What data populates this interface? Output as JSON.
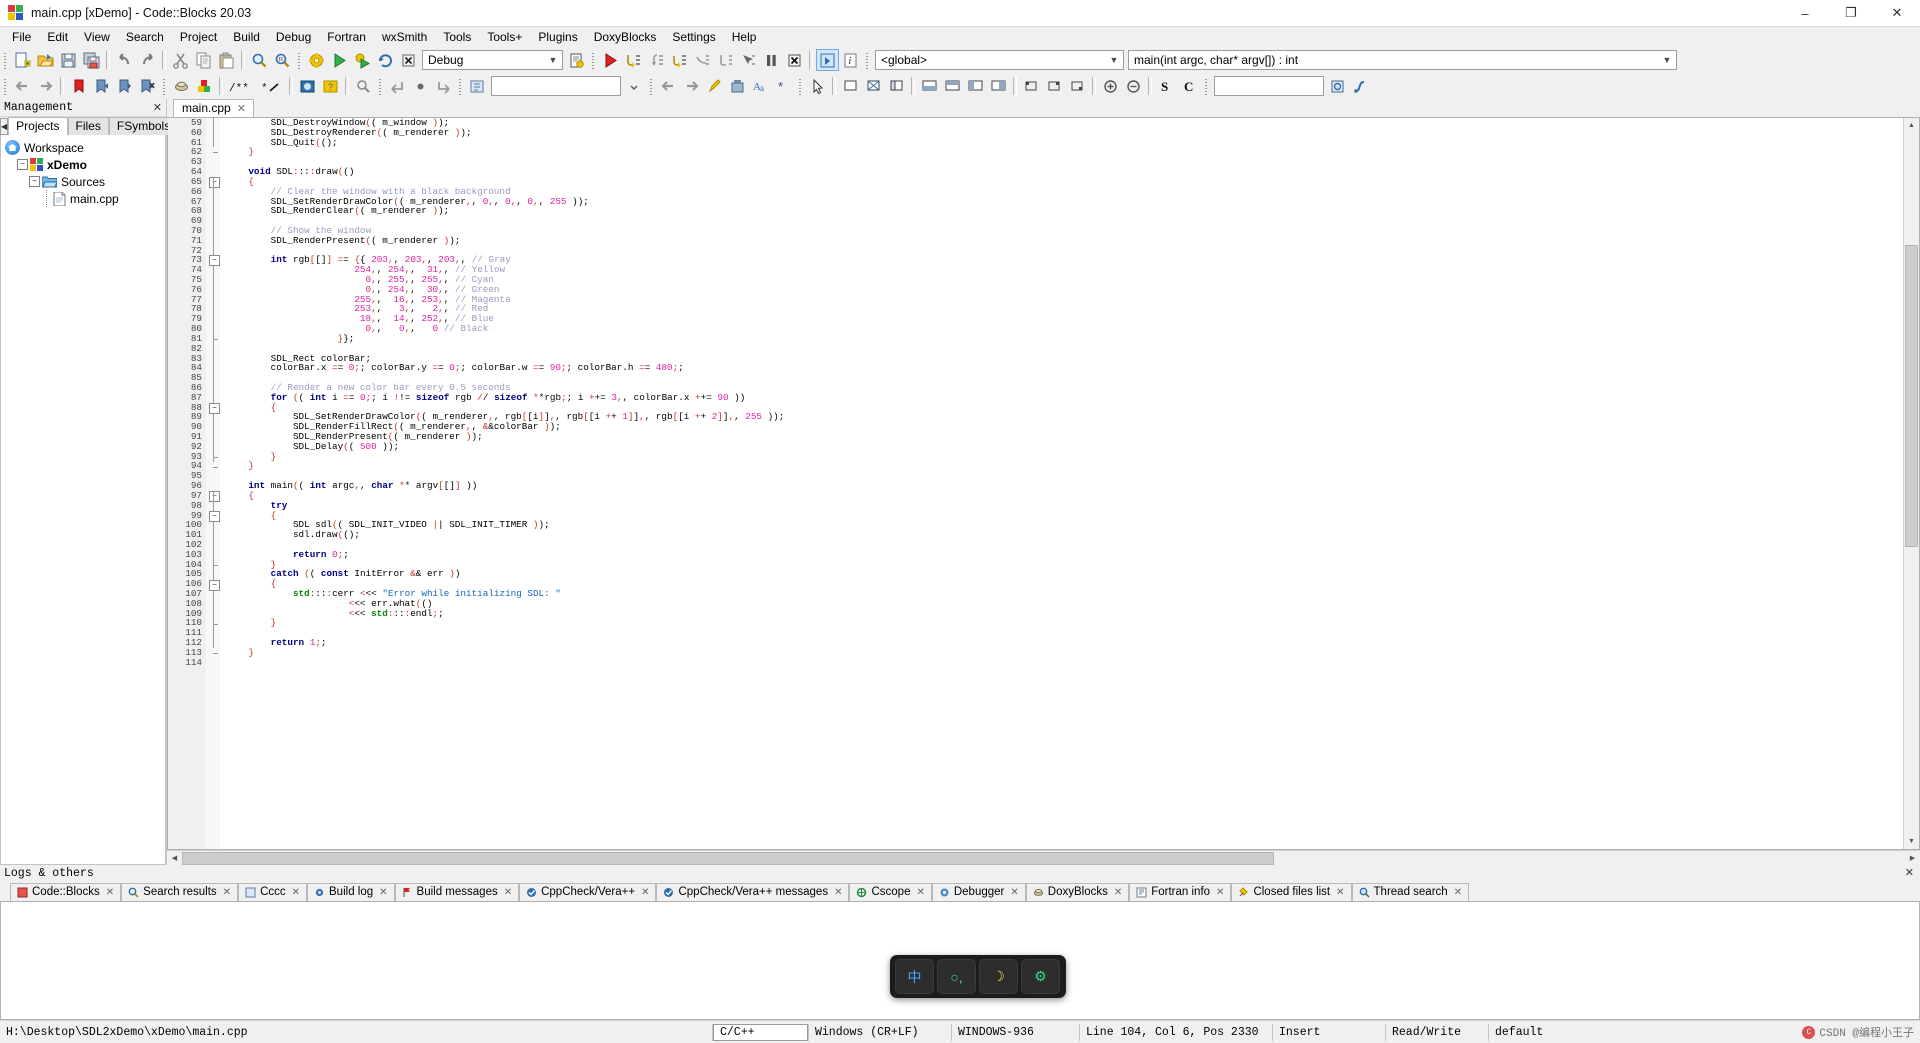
{
  "window": {
    "title": "main.cpp [xDemo] - Code::Blocks 20.03",
    "minimize": "–",
    "maximize": "❐",
    "close": "✕"
  },
  "menubar": [
    "File",
    "Edit",
    "View",
    "Search",
    "Project",
    "Build",
    "Debug",
    "Fortran",
    "wxSmith",
    "Tools",
    "Tools+",
    "Plugins",
    "DoxyBlocks",
    "Settings",
    "Help"
  ],
  "toolbars": {
    "main_icons": [
      "new-file-icon",
      "open-file-icon",
      "save-icon",
      "save-all-icon",
      "undo-icon",
      "redo-icon",
      "cut-icon",
      "copy-icon",
      "paste-icon",
      "find-icon",
      "replace-icon"
    ],
    "build_icons": [
      "build-icon",
      "run-icon",
      "build-and-run-icon",
      "rebuild-icon",
      "abort-icon"
    ],
    "target_combo": "Debug",
    "target_aux_icon": "select-target-icon",
    "debug_icons": [
      "debug-continue-icon",
      "step-into-icon",
      "step-out-icon",
      "next-line-icon",
      "next-instruction-icon",
      "step-into-instruction-icon",
      "run-to-cursor-icon",
      "break-debugger-icon",
      "stop-debugger-icon",
      "debugging-windows-icon",
      "various-info-icon"
    ],
    "scope_combo": "<global>",
    "function_combo": "main(int argc, char* argv[]) : int",
    "row2_icons": [
      "back-icon",
      "forward-icon",
      "toggle-bookmark-icon",
      "prev-bookmark-icon",
      "next-bookmark-icon",
      "clear-bookmarks-icon",
      "doxyblocks-extract-icon",
      "doxyblocks-wizard-icon",
      "comment-block-icon",
      "uncomment-icon",
      "doxyblocks-run-icon",
      "doxyblocks-help-icon",
      "doxyblocks-config-icon",
      "prev-changed-line-icon",
      "toggle-changebar-icon",
      "next-changed-line-icon",
      "fortran-workspace-icon"
    ],
    "fortran_combo": "",
    "row2b_icons": [
      "wxsmith-pointer-icon",
      "wxsmith-panel-icon",
      "wxsmith-dialog-icon",
      "wxsmith-frame-icon",
      "layout-h1-icon",
      "layout-h2-icon",
      "layout-v1-icon",
      "layout-v2-icon",
      "align-left-icon",
      "align-center-icon",
      "align-right-icon",
      "zoom-in-icon",
      "zoom-out-icon"
    ],
    "sc_labels": [
      "S",
      "C"
    ],
    "search_combo": "",
    "search_icons": [
      "search-files-icon",
      "search-symbol-icon"
    ]
  },
  "management": {
    "title": "Management",
    "close_icon": "✕",
    "scroll_left_icon": "◀",
    "tabs": [
      {
        "label": "Projects",
        "active": true
      },
      {
        "label": "Files",
        "active": false
      },
      {
        "label": "FSymbols",
        "active": false
      }
    ],
    "tree": [
      {
        "label": "Workspace",
        "icon": "workspace-home-icon",
        "depth": 0,
        "bold": false,
        "expander": ""
      },
      {
        "label": "xDemo",
        "icon": "project-icon",
        "depth": 1,
        "bold": true,
        "expander": "−"
      },
      {
        "label": "Sources",
        "icon": "folder-icon",
        "depth": 2,
        "bold": false,
        "expander": "−"
      },
      {
        "label": "main.cpp",
        "icon": "cpp-file-icon",
        "depth": 3,
        "bold": false,
        "expander": ""
      }
    ]
  },
  "editor": {
    "tabs": [
      {
        "label": "main.cpp",
        "close": "✕",
        "active": true
      }
    ],
    "first_line": 59,
    "lines": [
      {
        "n": 59,
        "t": "        SDL_DestroyWindow@(( m_window @));"
      },
      {
        "n": 60,
        "t": "        SDL_DestroyRenderer@(( m_renderer @));"
      },
      {
        "n": 61,
        "t": "        SDL_Quit@(();"
      },
      {
        "n": 62,
        "t": "    @}"
      },
      {
        "n": 63,
        "t": ""
      },
      {
        "n": 64,
        "t": "    @kvoid@ SDL@:::@:draw@(()"
      },
      {
        "n": 65,
        "t": "    @{"
      },
      {
        "n": 66,
        "t": "        @c// Clear the window with a black background"
      },
      {
        "n": 67,
        "t": "        SDL_SetRenderDrawColor@(( m_renderer@,, @n0@,, @n0@,, @n0@,, @n255@ ));"
      },
      {
        "n": 68,
        "t": "        SDL_RenderClear@(( m_renderer @));"
      },
      {
        "n": 69,
        "t": ""
      },
      {
        "n": 70,
        "t": "        @c// Show the window"
      },
      {
        "n": 71,
        "t": "        SDL_RenderPresent@(( m_renderer @));"
      },
      {
        "n": 72,
        "t": ""
      },
      {
        "n": 73,
        "t": "        @kint@ rgb@[[]@] @== @{{ @n203@,, @n203@,, @n203@,, @c// Gray"
      },
      {
        "n": 74,
        "t": "                       @n254@,, @n254@,,  @n31@,, @c// Yellow"
      },
      {
        "n": 75,
        "t": "                         @n0@,, @n255@,, @n255@,, @c// Cyan"
      },
      {
        "n": 76,
        "t": "                         @n0@,, @n254@,,  @n30@,, @c// Green"
      },
      {
        "n": 77,
        "t": "                       @n255@,,  @n16@,, @n253@,, @c// Magenta"
      },
      {
        "n": 78,
        "t": "                       @n253@,,   @n3@,,   @n2@,, @c// Red"
      },
      {
        "n": 79,
        "t": "                        @n18@,,  @n14@,, @n252@,, @c// Blue"
      },
      {
        "n": 80,
        "t": "                         @n0@,,   @n0@,,   @n0@ @c// Black"
      },
      {
        "n": 81,
        "t": "                    @}};"
      },
      {
        "n": 82,
        "t": ""
      },
      {
        "n": 83,
        "t": "        SDL_Rect colorBar;"
      },
      {
        "n": 84,
        "t": "        colorBar.x @== @n0@;; colorBar.y @== @n0@;; colorBar.w @== @n90@;; colorBar.h @== @n480@;;"
      },
      {
        "n": 85,
        "t": ""
      },
      {
        "n": 86,
        "t": "        @c// Render a new color bar every 0.5 seconds"
      },
      {
        "n": 87,
        "t": "        @kfor@ @(( @kint@ i @== @n0@;; i @!!= @ksizeof@ rgb @// @ksizeof@ @**rgb@;; i @++= @n3@,, colorBar.x @++= @n90@ ))"
      },
      {
        "n": 88,
        "t": "        @{"
      },
      {
        "n": 89,
        "t": "            SDL_SetRenderDrawColor@(( m_renderer@,, rgb@[[i@]]@,, rgb@[[i @++ @n1@]]@,, rgb@[[i @++ @n2@]]@,, @n255@ ));"
      },
      {
        "n": 90,
        "t": "            SDL_RenderFillRect@(( m_renderer@,, @&&colorBar @));"
      },
      {
        "n": 91,
        "t": "            SDL_RenderPresent@(( m_renderer @));"
      },
      {
        "n": 92,
        "t": "            SDL_Delay@(( @n500@ ));"
      },
      {
        "n": 93,
        "t": "        @}"
      },
      {
        "n": 94,
        "t": "    @}"
      },
      {
        "n": 95,
        "t": ""
      },
      {
        "n": 96,
        "t": "    @kint@ main@(( @kint@ argc@,, @kchar@ @** argv@[[]@] ))"
      },
      {
        "n": 97,
        "t": "    @{"
      },
      {
        "n": 98,
        "t": "        @ktry"
      },
      {
        "n": 99,
        "t": "        @{"
      },
      {
        "n": 100,
        "t": "            SDL sdl@(( SDL_INIT_VIDEO @|| SDL_INIT_TIMER @));"
      },
      {
        "n": 101,
        "t": "            sdl.draw@(();"
      },
      {
        "n": 102,
        "t": ""
      },
      {
        "n": 103,
        "t": "            @kreturn@ @n0@;;"
      },
      {
        "n": 104,
        "t": "        @}"
      },
      {
        "n": 105,
        "t": "        @kcatch@ @(( @kconst@ InitError @&& err @))"
      },
      {
        "n": 106,
        "t": "        @{"
      },
      {
        "n": 107,
        "t": "            @pstd@:::@:cerr@ @<<< @s\"Error while initializing SDL: \""
      },
      {
        "n": 108,
        "t": "                      @<<< err.what@(()"
      },
      {
        "n": 109,
        "t": "                      @<<< @pstd@:::@:endl@;;"
      },
      {
        "n": 110,
        "t": "        @}"
      },
      {
        "n": 111,
        "t": ""
      },
      {
        "n": 112,
        "t": "        @kreturn@ @n1@;;"
      },
      {
        "n": 113,
        "t": "    @}"
      },
      {
        "n": 114,
        "t": ""
      }
    ]
  },
  "logs": {
    "title": "Logs & others",
    "close_icon": "✕",
    "tabs": [
      {
        "label": "Code::Blocks",
        "icon": "codeblocks-log-icon",
        "active": false,
        "closable": true
      },
      {
        "label": "Search results",
        "icon": "search-icon",
        "active": false,
        "closable": true
      },
      {
        "label": "Cccc",
        "icon": "cccc-icon",
        "active": false,
        "closable": true
      },
      {
        "label": "Build log",
        "icon": "gear-icon",
        "active": false,
        "closable": true
      },
      {
        "label": "Build messages",
        "icon": "flag-icon",
        "active": false,
        "closable": true
      },
      {
        "label": "CppCheck/Vera++",
        "icon": "check-icon",
        "active": false,
        "closable": true
      },
      {
        "label": "CppCheck/Vera++ messages",
        "icon": "check-messages-icon",
        "active": false,
        "closable": true
      },
      {
        "label": "Cscope",
        "icon": "cscope-icon",
        "active": false,
        "closable": true
      },
      {
        "label": "Debugger",
        "icon": "debugger-icon",
        "active": false,
        "closable": true
      },
      {
        "label": "DoxyBlocks",
        "icon": "doxyblocks-icon",
        "active": false,
        "closable": true
      },
      {
        "label": "Fortran info",
        "icon": "fortran-icon",
        "active": false,
        "closable": true
      },
      {
        "label": "Closed files list",
        "icon": "closed-files-icon",
        "active": false,
        "closable": true
      },
      {
        "label": "Thread search",
        "icon": "thread-search-icon",
        "active": false,
        "closable": true
      }
    ]
  },
  "ime": {
    "keys": [
      {
        "glyph": "中",
        "name": "chinese-mode-key"
      },
      {
        "glyph": "○,",
        "name": "punctuation-key"
      },
      {
        "glyph": "☽",
        "name": "moon-key"
      },
      {
        "glyph": "⚙",
        "name": "toolbox-key"
      }
    ]
  },
  "statusbar": {
    "path": "H:\\Desktop\\SDL2xDemo\\xDemo\\main.cpp",
    "language": "C/C++",
    "line_endings": "Windows (CR+LF)",
    "encoding": "WINDOWS-936",
    "position": "Line 104, Col 6, Pos 2330",
    "insert_mode": "Insert",
    "readwrite": "Read/Write",
    "profile": "default",
    "watermark": "CSDN @编程小王子"
  }
}
